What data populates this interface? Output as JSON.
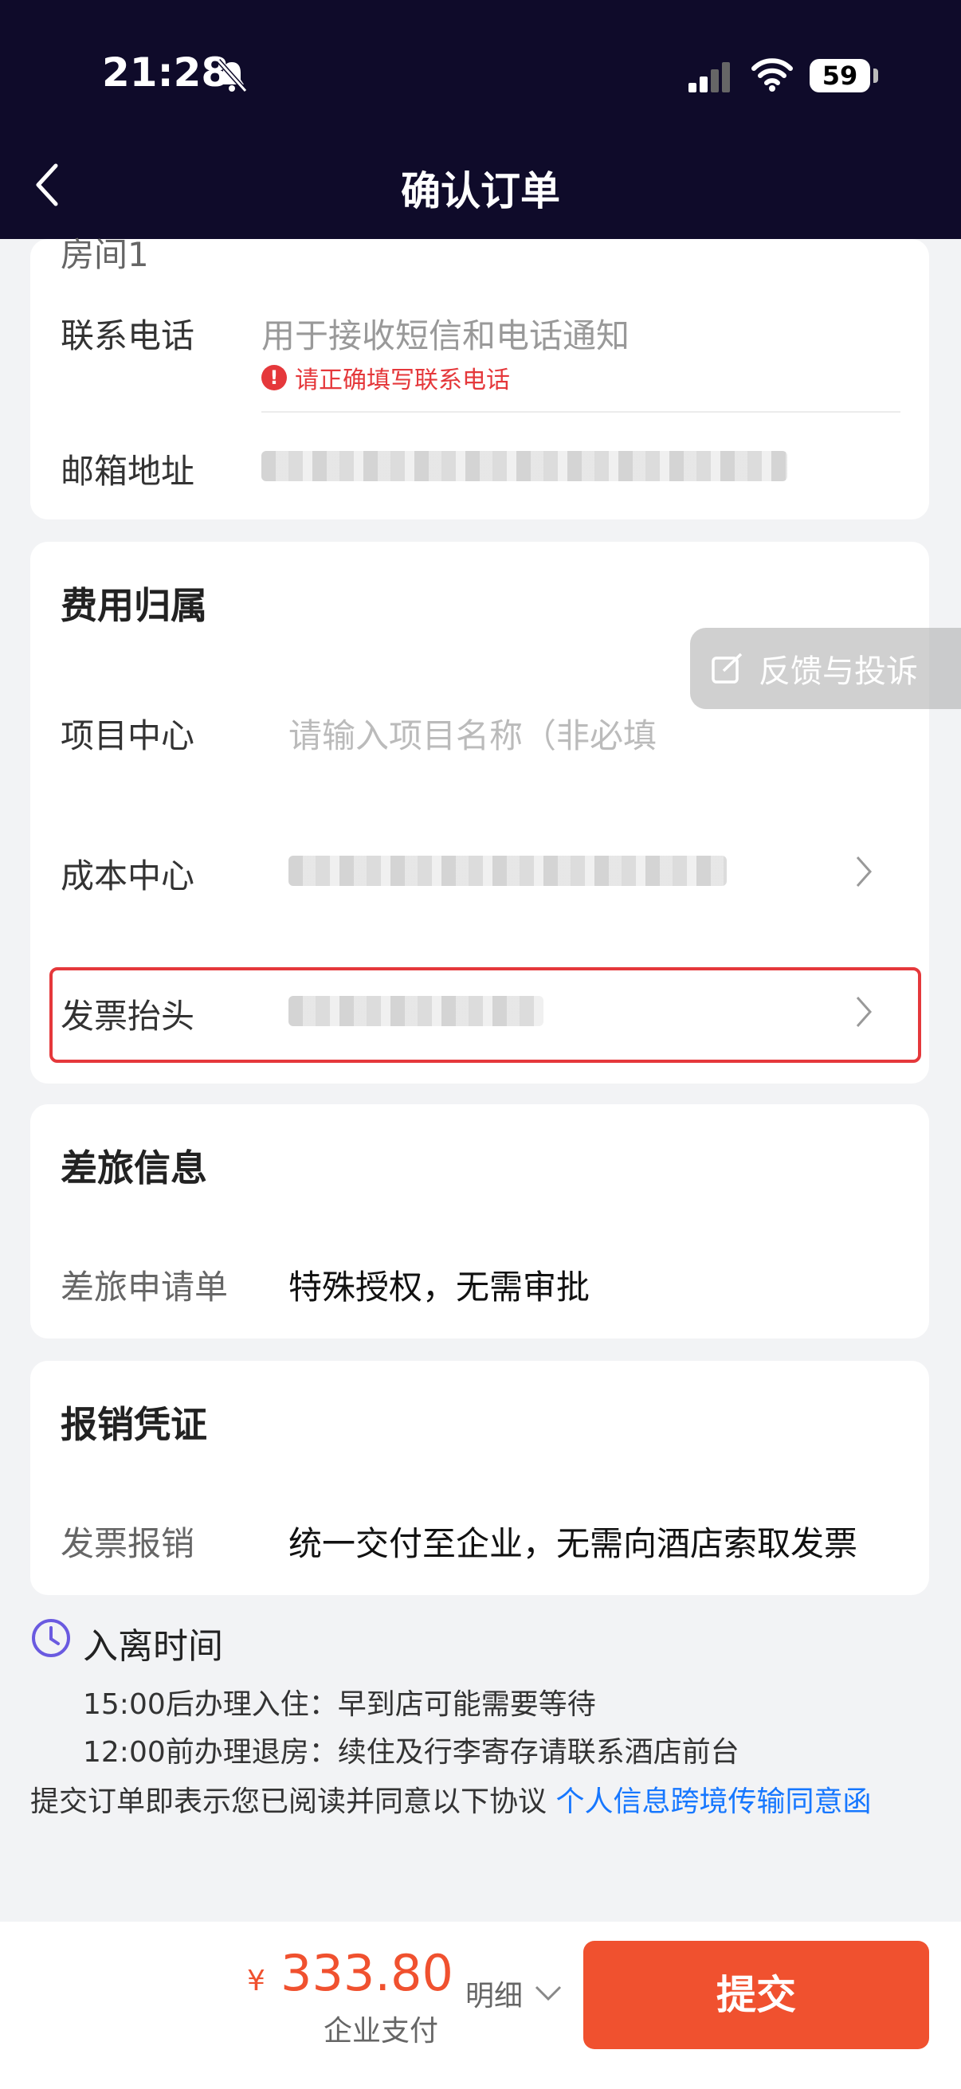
{
  "status_bar": {
    "time": "21:28",
    "battery": "59"
  },
  "header": {
    "title": "确认订单"
  },
  "contact_card": {
    "room_label": "房间1",
    "phone_label": "联系电话",
    "phone_placeholder": "用于接收短信和电话通知",
    "phone_error": "请正确填写联系电话",
    "email_label": "邮箱地址"
  },
  "cost_card": {
    "title": "费用归属",
    "project_label": "项目中心",
    "project_placeholder": "请输入项目名称（非必填",
    "cost_center_label": "成本中心",
    "invoice_title_label": "发票抬头"
  },
  "feedback": {
    "label": "反馈与投诉"
  },
  "travel_card": {
    "title": "差旅信息",
    "application_label": "差旅申请单",
    "application_value": "特殊授权，无需审批"
  },
  "reimburse_card": {
    "title": "报销凭证",
    "invoice_label": "发票报销",
    "invoice_value": "统一交付至企业，无需向酒店索取发票"
  },
  "checkin": {
    "title": "入离时间",
    "checkin_line": "15:00后办理入住：早到店可能需要等待",
    "checkout_line": "12:00前办理退房：续住及行李寄存请联系酒店前台"
  },
  "agreement": {
    "text": "提交订单即表示您已阅读并同意以下协议",
    "link": "个人信息跨境传输同意函"
  },
  "bottom_bar": {
    "currency": "¥",
    "price": "333.80",
    "pay_method": "企业支付",
    "detail_label": "明细",
    "submit_label": "提交"
  },
  "colors": {
    "accent": "#f0512f",
    "error": "#e5383b",
    "link": "#1677ff",
    "header_bg": "#0f0b2a"
  }
}
